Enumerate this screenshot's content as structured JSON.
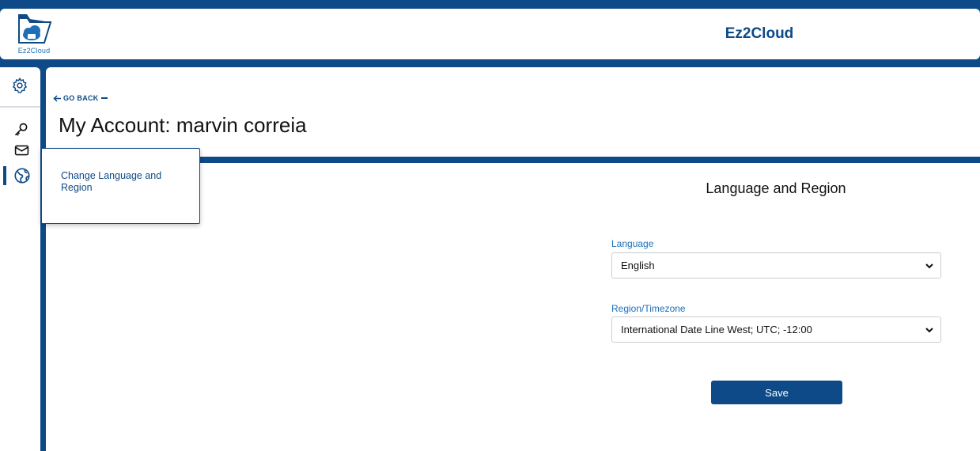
{
  "header": {
    "logo_text": "Ez2Cloud",
    "app_title": "Ez2Cloud"
  },
  "sidebar": {
    "items": [
      {
        "icon": "gear-icon"
      },
      {
        "icon": "key-icon"
      },
      {
        "icon": "envelope-icon"
      },
      {
        "icon": "globe-icon",
        "active": true
      }
    ]
  },
  "page": {
    "go_back": "GO BACK",
    "title": "My Account: marvin correia"
  },
  "popover": {
    "item_label": "Change Language and Region"
  },
  "form": {
    "heading": "Language and Region",
    "language_label": "Language",
    "language_value": "English",
    "region_label": "Region/Timezone",
    "region_value": "International Date Line West; UTC; -12:00",
    "save_label": "Save"
  },
  "colors": {
    "brand": "#0d4a87",
    "link": "#1d6fb8"
  }
}
